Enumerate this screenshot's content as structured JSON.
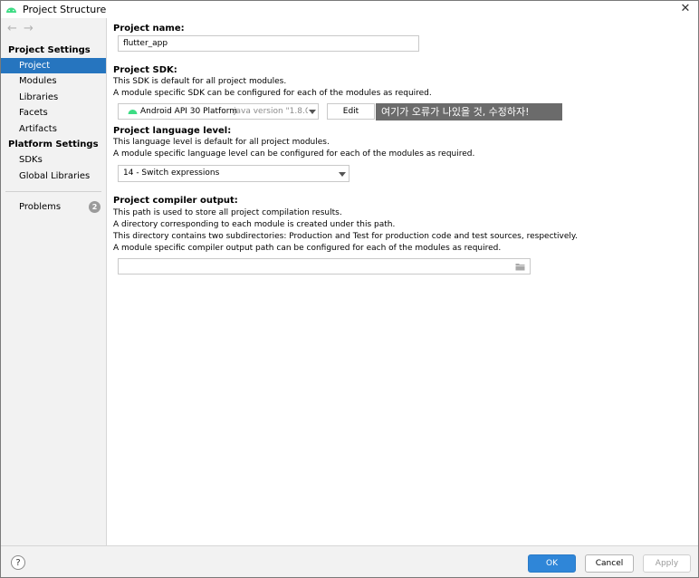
{
  "window": {
    "title": "Project Structure",
    "close_glyph": "✕"
  },
  "nav": {
    "back_glyph": "←",
    "forward_glyph": "→"
  },
  "sidebar": {
    "project_settings_heading": "Project Settings",
    "project_settings_items": [
      "Project",
      "Modules",
      "Libraries",
      "Facets",
      "Artifacts"
    ],
    "selected_item": "Project",
    "platform_settings_heading": "Platform Settings",
    "platform_settings_items": [
      "SDKs",
      "Global Libraries"
    ],
    "problems_label": "Problems",
    "problems_count": "2"
  },
  "main": {
    "project_name": {
      "label": "Project name:",
      "value": "flutter_app"
    },
    "project_sdk": {
      "label": "Project SDK:",
      "desc1": "This SDK is default for all project modules.",
      "desc2": "A module specific SDK can be configured for each of the modules as required.",
      "selected": "Android API 30 Platform",
      "version_hint": "java version \"1.8.0_",
      "edit_label": "Edit",
      "annotation": "여기가 오류가 나있을 것, 수정하자!"
    },
    "language_level": {
      "label": "Project language level:",
      "desc1": "This language level is default for all project modules.",
      "desc2": "A module specific language level can be configured for each of the modules as required.",
      "selected": "14 - Switch expressions"
    },
    "compiler_output": {
      "label": "Project compiler output:",
      "desc1": "This path is used to store all project compilation results.",
      "desc2": "A directory corresponding to each module is created under this path.",
      "desc3": "This directory contains two subdirectories: Production and Test for production code and test sources, respectively.",
      "desc4": "A module specific compiler output path can be configured for each of the modules as required.",
      "value": ""
    }
  },
  "footer": {
    "help_glyph": "?",
    "ok_label": "OK",
    "cancel_label": "Cancel",
    "apply_label": "Apply"
  },
  "icons": {
    "app": "android-icon",
    "sdk": "android-icon",
    "browse": "folder-icon",
    "help": "help-icon"
  },
  "colors": {
    "selection": "#2675bf",
    "ok_button": "#2f86d8",
    "annotation_bg": "#6b6b6b",
    "android_green": "#3ddc84"
  }
}
